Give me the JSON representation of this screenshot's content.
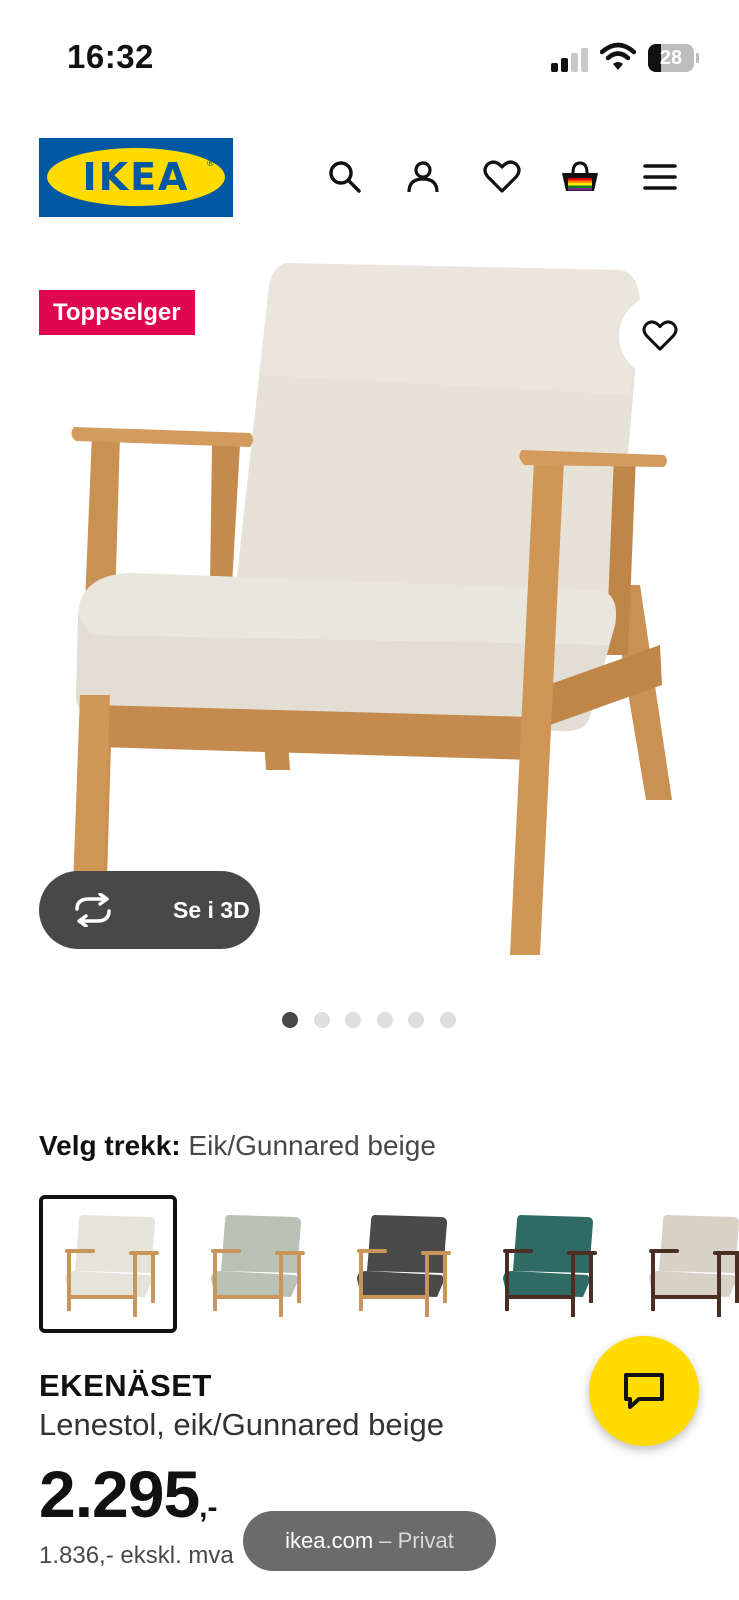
{
  "status_bar": {
    "time": "16:32",
    "battery_level": "28",
    "battery_fraction": 0.28
  },
  "header": {
    "logo_text": "IKEA",
    "logo_registered": "®",
    "icons": [
      "search-icon",
      "account-icon",
      "heart-icon",
      "basket-icon",
      "menu-icon"
    ]
  },
  "gallery": {
    "badge": "Toppselger",
    "view_3d_label": "Se i 3D",
    "dots_total": 6,
    "dots_active": 1
  },
  "variant": {
    "label": "Velg trekk:",
    "value": "Eik/Gunnared beige",
    "swatches": [
      {
        "fabric": "#e6e3da",
        "frame": "#c9955a",
        "selected": true
      },
      {
        "fabric": "#b9c3b5",
        "frame": "#c9955a",
        "selected": false
      },
      {
        "fabric": "#4a4a4a",
        "frame": "#c9955a",
        "selected": false
      },
      {
        "fabric": "#2f6a64",
        "frame": "#4a2f22",
        "selected": false
      },
      {
        "fabric": "#d8d1c6",
        "frame": "#4a2f22",
        "selected": false
      }
    ]
  },
  "product": {
    "name": "EKENÄSET",
    "description": "Lenestol, eik/Gunnared beige",
    "price_main": "2.295",
    "price_suffix": ",-",
    "price_ex_vat": "1.836,- ekskl. mva"
  },
  "browser": {
    "domain": "ikea.com",
    "separator": " – ",
    "mode": "Privat"
  },
  "colors": {
    "ikea_blue": "#0058a3",
    "ikea_yellow": "#ffdb00",
    "badge_red": "#e00751",
    "dark_pill": "#484848"
  }
}
